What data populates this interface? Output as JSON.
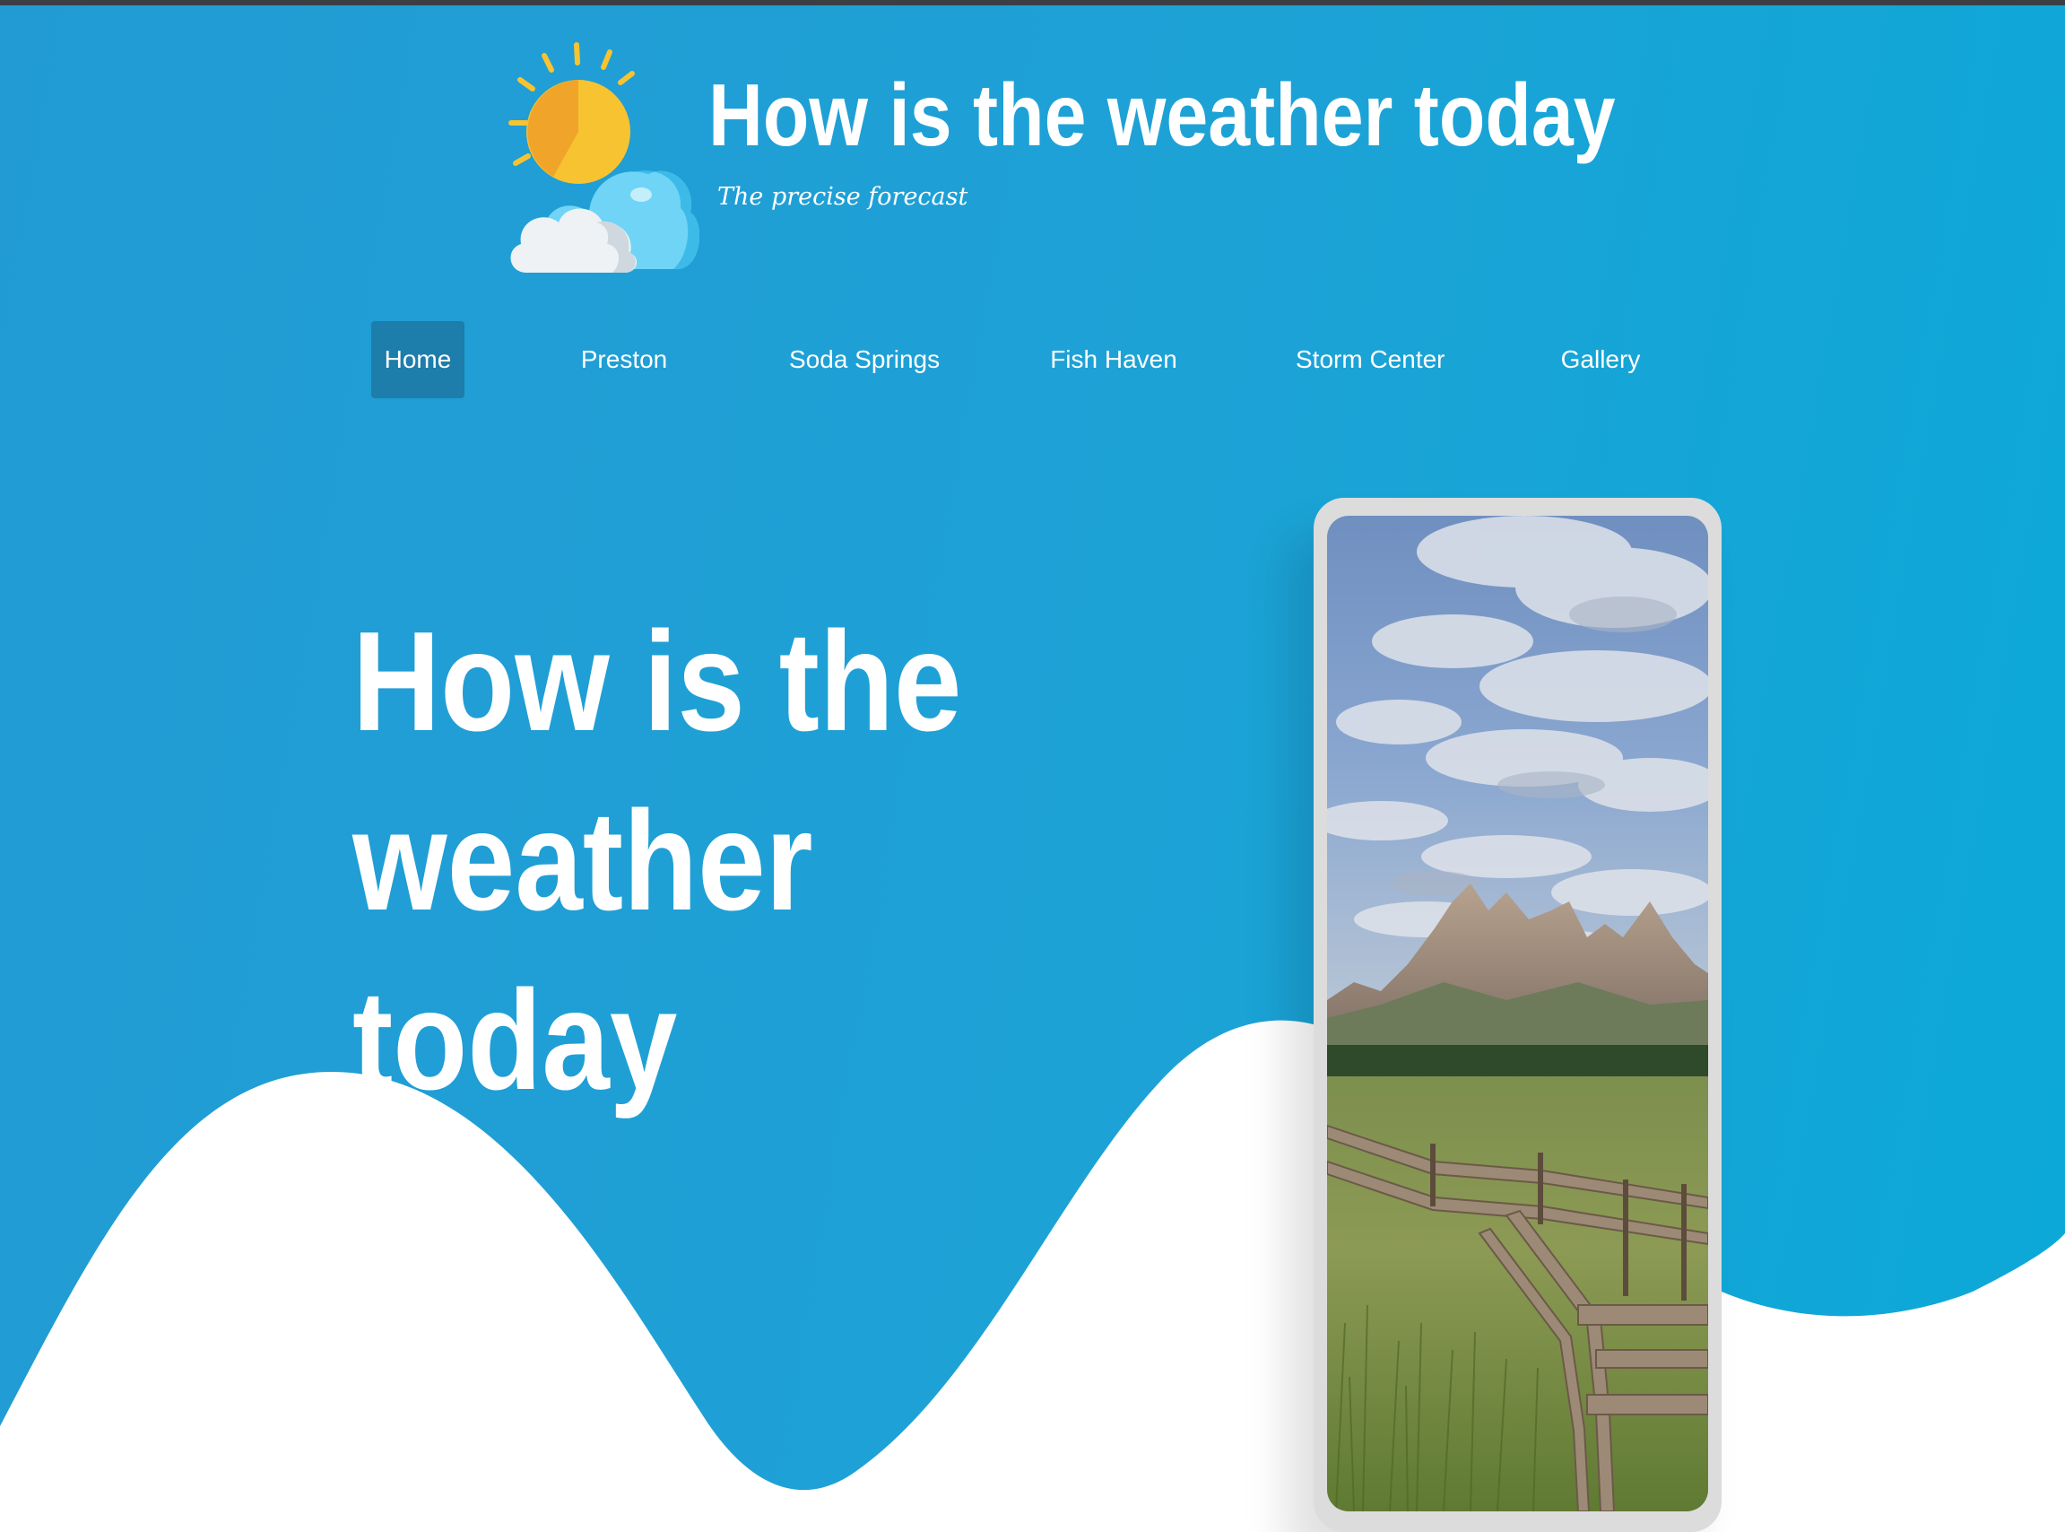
{
  "header": {
    "title": "How is the weather today",
    "tagline": "The precise forecast",
    "logo_icon": "sun-behind-cloud-icon"
  },
  "nav": {
    "items": [
      {
        "label": "Home",
        "active": true
      },
      {
        "label": "Preston",
        "active": false
      },
      {
        "label": "Soda Springs",
        "active": false
      },
      {
        "label": "Fish Haven",
        "active": false
      },
      {
        "label": "Storm Center",
        "active": false
      },
      {
        "label": "Gallery",
        "active": false
      }
    ]
  },
  "hero": {
    "heading": "How is the weather today",
    "image": "phone-mockup-mountain-meadow-fence"
  },
  "colors": {
    "background": "#1da2d6",
    "nav_active": "#1d7dab",
    "text": "#ffffff",
    "wave": "#ffffff",
    "phone_frame": "#dcdcdc"
  }
}
